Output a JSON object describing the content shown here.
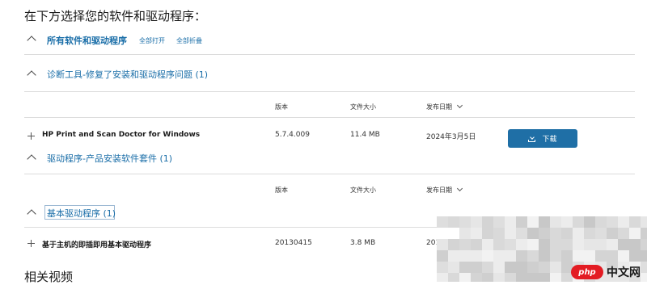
{
  "page_title": "在下方选择您的软件和驱动程序：",
  "header": {
    "all_label": "所有软件和驱动程序",
    "expand_all": "全部打开",
    "collapse_all": "全部折叠"
  },
  "sections": [
    {
      "title": "诊断工具-修复了安装和驱动程序问题 (1)",
      "columns": {
        "version": "版本",
        "size": "文件大小",
        "date": "发布日期"
      },
      "rows": [
        {
          "name": "HP Print and Scan Doctor for Windows",
          "version": "5.7.4.009",
          "size": "11.4 MB",
          "date": "2024年3月5日",
          "action": "下载"
        }
      ]
    },
    {
      "title": "驱动程序-产品安装软件套件 (1)",
      "columns": {
        "version": "版本",
        "size": "文件大小",
        "date": "发布日期"
      }
    },
    {
      "title": "基本驱动程序 (1)",
      "rows": [
        {
          "name": "基于主机的即插即用基本驱动程序",
          "version": "20130415",
          "size": "3.8 MB",
          "date": "201"
        }
      ]
    }
  ],
  "related_heading": "相关视频",
  "watermark": {
    "logo": "php",
    "text": "中文网"
  }
}
